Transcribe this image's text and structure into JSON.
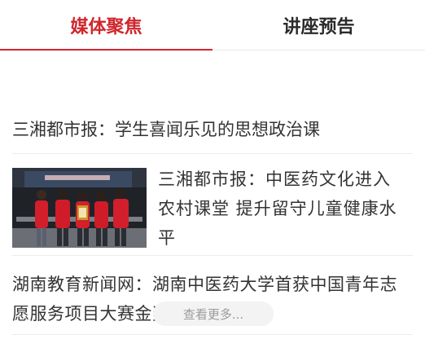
{
  "tabs": {
    "media_label": "媒体聚焦",
    "lecture_label": "讲座预告",
    "active": "media"
  },
  "news": [
    {
      "title": "三湘都市报：学生喜闻乐见的思想政治课",
      "has_thumbnail": false
    },
    {
      "title": "三湘都市报：中医药文化进入农村课堂 提升留守儿童健康水平",
      "has_thumbnail": true
    },
    {
      "title": "湖南教育新闻网：湖南中医药大学首获中国青年志愿服务项目大赛金奖",
      "has_thumbnail": false
    }
  ],
  "more_label": "查看更多...",
  "colors": {
    "accent": "#d0262c",
    "text": "#333333",
    "muted": "#9b9b9b"
  }
}
